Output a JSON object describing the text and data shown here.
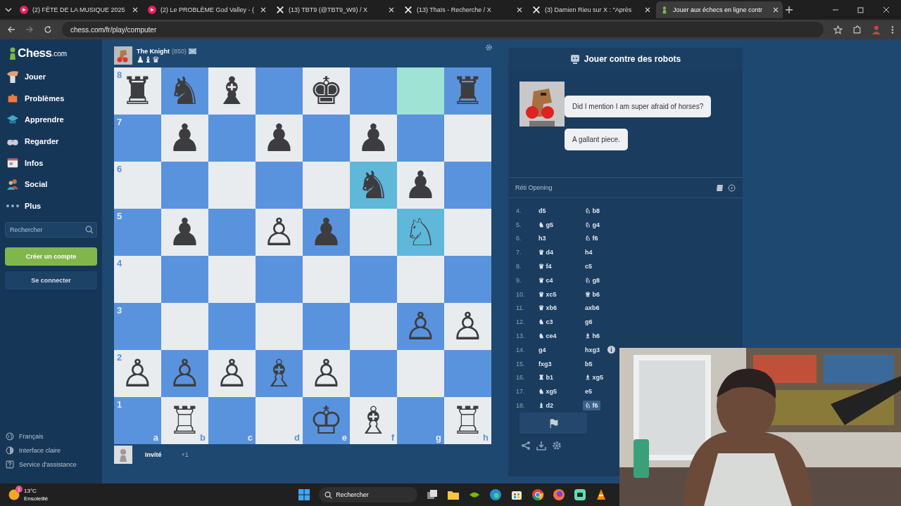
{
  "browser": {
    "tabs": [
      {
        "label": "(2) FÊTE DE LA MUSIQUE 2025",
        "kind": "video",
        "selected": false
      },
      {
        "label": "(2) Le PROBLÈME God Valley - (",
        "kind": "video",
        "selected": false
      },
      {
        "label": "(13) TBT9 (@TBT9_W9) / X",
        "kind": "x",
        "selected": false
      },
      {
        "label": "(13) Thaïs - Recherche / X",
        "kind": "x",
        "selected": false
      },
      {
        "label": "(3) Damien Rieu sur X : \"Après",
        "kind": "x",
        "selected": false
      },
      {
        "label": "Jouer aux échecs en ligne contr",
        "kind": "pawn",
        "selected": true
      }
    ],
    "url": "chess.com/fr/play/computer"
  },
  "sidebar": {
    "logo": "Chess",
    "logo_suffix": ".com",
    "items": [
      {
        "label": "Jouer",
        "kind": "hand"
      },
      {
        "label": "Problèmes",
        "kind": "puzzle"
      },
      {
        "label": "Apprendre",
        "kind": "cap"
      },
      {
        "label": "Regarder",
        "kind": "binoculars"
      },
      {
        "label": "Infos",
        "kind": "news"
      },
      {
        "label": "Social",
        "kind": "people"
      },
      {
        "label": "Plus",
        "kind": "dots"
      }
    ],
    "search": {
      "placeholder": "Rechercher"
    },
    "signup_button": "Créer un compte",
    "login_button": "Se connecter",
    "footer": [
      {
        "label": "Français",
        "kind": "globe"
      },
      {
        "label": "Interface claire",
        "kind": "contrast"
      },
      {
        "label": "Service d'assistance",
        "kind": "help"
      }
    ]
  },
  "top_player": {
    "name": "The Knight",
    "rating": "(850)",
    "captured": "♟♝♛"
  },
  "board": {
    "file_labels": [
      "a",
      "b",
      "c",
      "d",
      "e",
      "f",
      "g",
      "h"
    ],
    "ranks": [
      {
        "label": "8",
        "squares": [
          {
            "piece": "♜",
            "kind": "plain"
          },
          {
            "piece": "♞",
            "kind": "plain"
          },
          {
            "piece": "♝",
            "kind": "plain"
          },
          {
            "kind": "plain"
          },
          {
            "piece": "♚",
            "kind": "plain"
          },
          {
            "kind": "plain"
          },
          {
            "kind": "hint"
          },
          {
            "piece": "♜",
            "kind": "plain"
          }
        ]
      },
      {
        "label": "7",
        "squares": [
          {
            "kind": "plain"
          },
          {
            "piece": "♟",
            "kind": "plain"
          },
          {
            "kind": "plain"
          },
          {
            "piece": "♟",
            "kind": "plain"
          },
          {
            "kind": "plain"
          },
          {
            "piece": "♟",
            "kind": "plain"
          },
          {
            "kind": "plain"
          },
          {
            "kind": "plain"
          }
        ]
      },
      {
        "label": "6",
        "squares": [
          {
            "kind": "plain"
          },
          {
            "kind": "plain"
          },
          {
            "kind": "plain"
          },
          {
            "kind": "plain"
          },
          {
            "kind": "plain"
          },
          {
            "piece": "♞",
            "kind": "move"
          },
          {
            "piece": "♟",
            "kind": "plain"
          },
          {
            "kind": "plain"
          }
        ]
      },
      {
        "label": "5",
        "squares": [
          {
            "kind": "plain"
          },
          {
            "piece": "♟",
            "kind": "plain"
          },
          {
            "kind": "plain"
          },
          {
            "piece": "♙",
            "kind": "plain"
          },
          {
            "piece": "♟",
            "kind": "plain"
          },
          {
            "kind": "plain"
          },
          {
            "piece": "♘",
            "kind": "move"
          },
          {
            "kind": "plain"
          }
        ]
      },
      {
        "label": "4",
        "squares": [
          {
            "kind": "plain"
          },
          {
            "kind": "plain"
          },
          {
            "kind": "plain"
          },
          {
            "kind": "plain"
          },
          {
            "kind": "plain"
          },
          {
            "kind": "plain"
          },
          {
            "kind": "plain"
          },
          {
            "kind": "plain"
          }
        ]
      },
      {
        "label": "3",
        "squares": [
          {
            "kind": "plain"
          },
          {
            "kind": "plain"
          },
          {
            "kind": "plain"
          },
          {
            "kind": "plain"
          },
          {
            "kind": "plain"
          },
          {
            "kind": "plain"
          },
          {
            "piece": "♙",
            "kind": "plain"
          },
          {
            "piece": "♙",
            "kind": "plain"
          }
        ]
      },
      {
        "label": "2",
        "squares": [
          {
            "piece": "♙",
            "kind": "plain"
          },
          {
            "piece": "♙",
            "kind": "plain"
          },
          {
            "piece": "♙",
            "kind": "plain"
          },
          {
            "piece": "♗",
            "kind": "plain"
          },
          {
            "piece": "♙",
            "kind": "plain"
          },
          {
            "kind": "plain"
          },
          {
            "kind": "plain"
          },
          {
            "kind": "plain"
          }
        ]
      },
      {
        "label": "1",
        "squares": [
          {
            "kind": "plain"
          },
          {
            "piece": "♖",
            "kind": "plain"
          },
          {
            "kind": "plain"
          },
          {
            "kind": "plain"
          },
          {
            "piece": "♔",
            "kind": "plain"
          },
          {
            "piece": "♗",
            "kind": "plain"
          },
          {
            "kind": "plain"
          },
          {
            "piece": "♖",
            "kind": "plain"
          }
        ]
      }
    ]
  },
  "bottom_player": {
    "name": "Invité",
    "advantage": "+1"
  },
  "panel": {
    "title": "Jouer contre des robots",
    "messages": [
      "Did I mention I am super afraid of horses?",
      "A gallant piece."
    ],
    "opening": "Réti Opening",
    "moves": [
      {
        "number": "4.",
        "white": "d5",
        "black": "♘ b8",
        "selected": false
      },
      {
        "number": "5.",
        "white": "♞ g5",
        "black": "♘ g4",
        "selected": false
      },
      {
        "number": "6.",
        "white": "h3",
        "black": "♘ f6",
        "selected": false
      },
      {
        "number": "7.",
        "white": "♛ d4",
        "black": "h4",
        "selected": false
      },
      {
        "number": "8.",
        "white": "♛ f4",
        "black": "c5",
        "selected": false
      },
      {
        "number": "9.",
        "white": "♛ c4",
        "black": "♘ g8",
        "selected": false
      },
      {
        "number": "10.",
        "white": "♛ xc5",
        "black": "♕ b6",
        "selected": false
      },
      {
        "number": "11.",
        "white": "♛ xb6",
        "black": "axb6",
        "selected": false
      },
      {
        "number": "12.",
        "white": "♞ c3",
        "black": "g6",
        "selected": false
      },
      {
        "number": "13.",
        "white": "♞ ce4",
        "black": "♗ h6",
        "selected": false
      },
      {
        "number": "14.",
        "white": "g4",
        "black": "hxg3",
        "note": true,
        "selected": false
      },
      {
        "number": "15.",
        "white": "fxg3",
        "black": "b5",
        "selected": false
      },
      {
        "number": "16.",
        "white": "♜ b1",
        "black": "♗ xg5",
        "selected": false
      },
      {
        "number": "17.",
        "white": "♞ xg5",
        "black": "e5",
        "selected": false
      },
      {
        "number": "18.",
        "white": "♝ d2",
        "black": "♘ f6",
        "selected": true
      }
    ]
  },
  "taskbar": {
    "weather": {
      "temperature": "13°C",
      "condition": "Ensoleillé",
      "badge": "1"
    },
    "search": {
      "placeholder": "Rechercher"
    }
  }
}
